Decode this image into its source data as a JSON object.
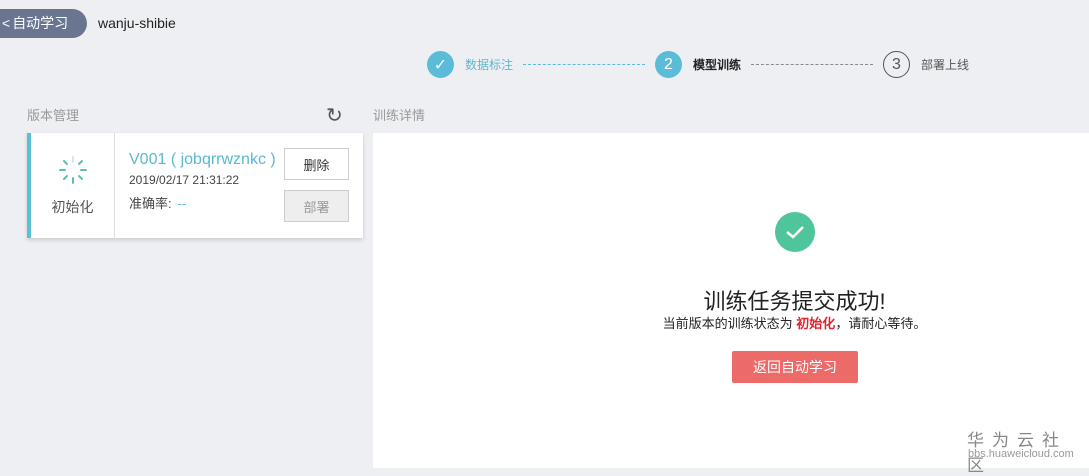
{
  "header": {
    "back_label": "自动学习",
    "project_name": "wanju-shibie"
  },
  "steps": [
    {
      "num": "✓",
      "label": "数据标注",
      "state": "done"
    },
    {
      "num": "2",
      "label": "模型训练",
      "state": "active"
    },
    {
      "num": "3",
      "label": "部署上线",
      "state": "pending"
    }
  ],
  "version_panel": {
    "title": "版本管理",
    "card": {
      "status": "初始化",
      "version": "V001 ( jobqrrwznkc )",
      "date": "2019/02/17 21:31:22",
      "accuracy_label": "准确率:",
      "accuracy_value": "--",
      "delete_label": "删除",
      "deploy_label": "部署"
    }
  },
  "detail": {
    "title": "训练详情",
    "success_title": "训练任务提交成功!",
    "status_prefix": "当前版本的训练状态为",
    "status_value": "初始化",
    "status_suffix": "，请耐心等待。",
    "return_label": "返回自动学习"
  },
  "watermark": {
    "name": "华为云社区",
    "url": "bbs.huaweicloud.com"
  }
}
